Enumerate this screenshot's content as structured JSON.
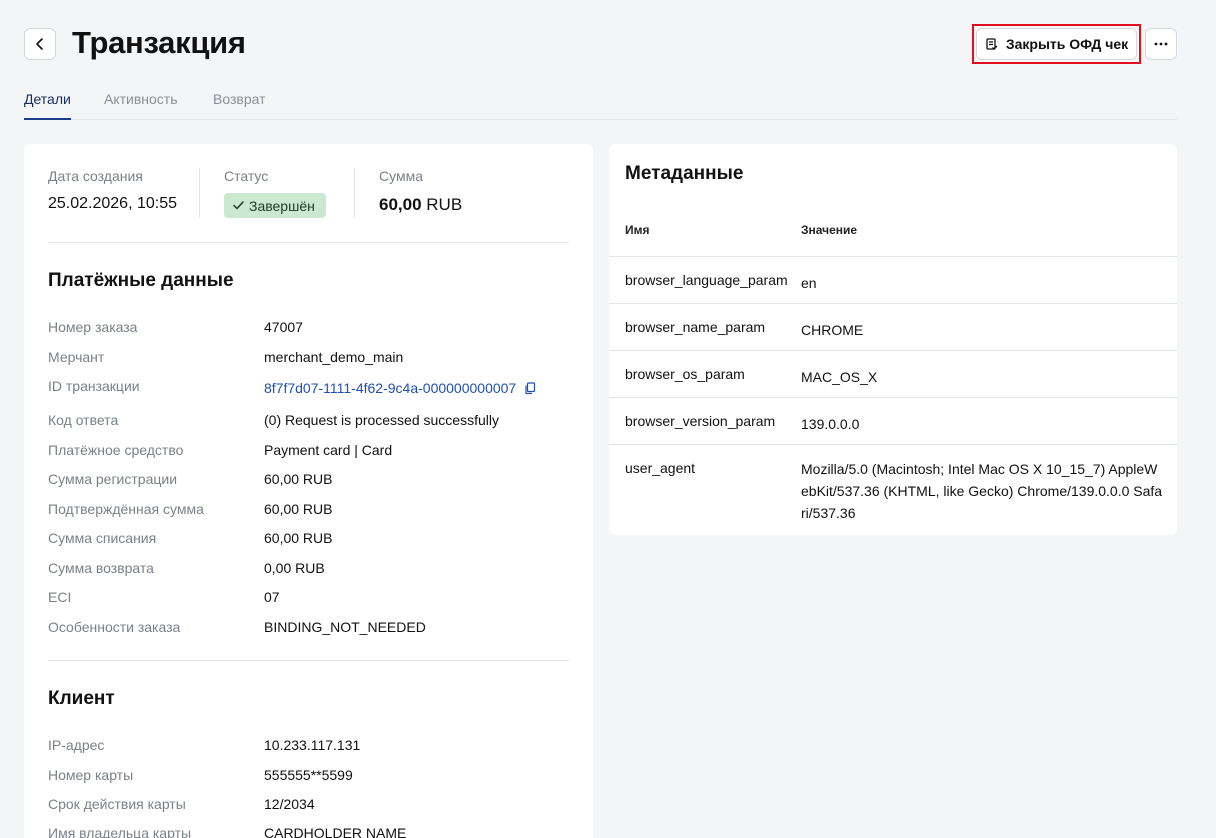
{
  "header": {
    "title": "Транзакция",
    "ofd_button": "Закрыть ОФД чек"
  },
  "tabs": [
    {
      "label": "Детали",
      "active": true
    },
    {
      "label": "Активность",
      "active": false
    },
    {
      "label": "Возврат",
      "active": false
    }
  ],
  "summary": {
    "created_label": "Дата создания",
    "created_value": "25.02.2026, 10:55",
    "status_label": "Статус",
    "status_value": "Завершён",
    "amount_label": "Сумма",
    "amount_number": "60,00",
    "amount_currency": "RUB"
  },
  "payment": {
    "title": "Платёжные данные",
    "rows": [
      {
        "label": "Номер заказа",
        "value": "47007"
      },
      {
        "label": "Мерчант",
        "value": "merchant_demo_main"
      },
      {
        "label": "ID транзакции",
        "value": "8f7f7d07-1111-4f62-9c4a-000000000007"
      },
      {
        "label": "Код ответа",
        "value": "(0) Request is processed successfully"
      },
      {
        "label": "Платёжное средство",
        "value": "Payment card | Card"
      },
      {
        "label": "Сумма регистрации",
        "value": "60,00 RUB"
      },
      {
        "label": "Подтверждённая сумма",
        "value": "60,00 RUB"
      },
      {
        "label": "Сумма списания",
        "value": "60,00 RUB"
      },
      {
        "label": "Сумма возврата",
        "value": "0,00 RUB"
      },
      {
        "label": "ECI",
        "value": "07"
      },
      {
        "label": "Особенности заказа",
        "value": "BINDING_NOT_NEEDED"
      }
    ]
  },
  "client": {
    "title": "Клиент",
    "rows": [
      {
        "label": "IP-адрес",
        "value": "10.233.117.131"
      },
      {
        "label": "Номер карты",
        "value": "555555**5599"
      },
      {
        "label": "Срок действия карты",
        "value": "12/2034"
      },
      {
        "label": "Имя владельца карты",
        "value": "CARDHOLDER NAME"
      }
    ]
  },
  "metadata": {
    "title": "Метаданные",
    "col_name": "Имя",
    "col_value": "Значение",
    "rows": [
      {
        "name": "browser_language_param",
        "value": "en"
      },
      {
        "name": "browser_name_param",
        "value": "CHROME"
      },
      {
        "name": "browser_os_param",
        "value": "MAC_OS_X"
      },
      {
        "name": "browser_version_param",
        "value": "139.0.0.0"
      },
      {
        "name": "user_agent",
        "value": "Mozilla/5.0 (Macintosh; Intel Mac OS X 10_15_7) AppleWebKit/537.36 (KHTML, like Gecko) Chrome/139.0.0.0 Safari/537.36"
      }
    ]
  },
  "colors": {
    "accent": "#1f3c8a",
    "link": "#1f4fb5",
    "status_bg": "#cbe9d1",
    "highlight": "#e0101e"
  }
}
